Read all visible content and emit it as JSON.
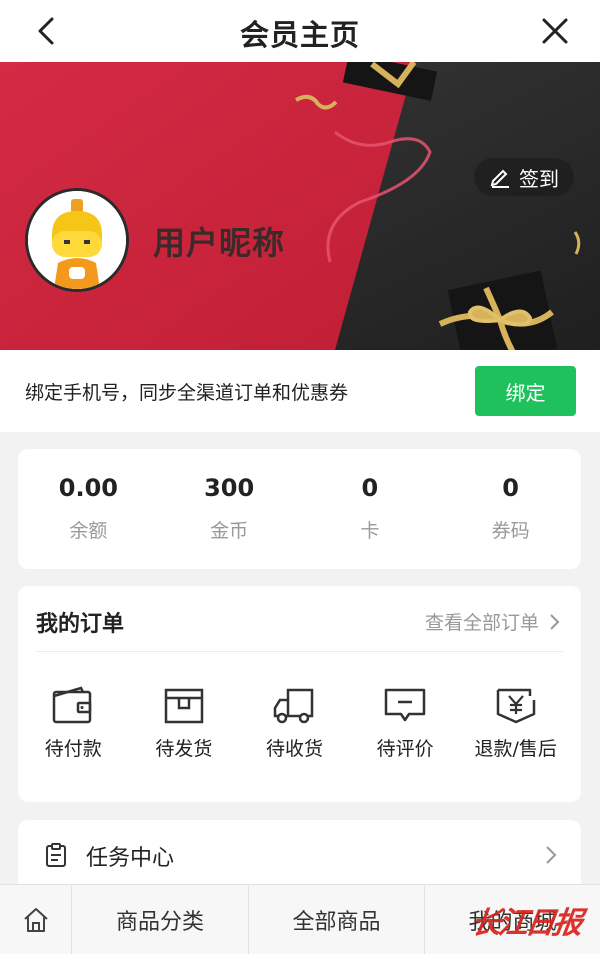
{
  "header": {
    "title": "会员主页"
  },
  "banner": {
    "nickname": "用户昵称",
    "signin_label": "签到"
  },
  "bind": {
    "prompt": "绑定手机号，同步全渠道订单和优惠券",
    "button_label": "绑定"
  },
  "stats": [
    {
      "value": "0.00",
      "label": "余额"
    },
    {
      "value": "300",
      "label": "金币"
    },
    {
      "value": "0",
      "label": "卡"
    },
    {
      "value": "0",
      "label": "券码"
    }
  ],
  "orders": {
    "title": "我的订单",
    "view_all": "查看全部订单",
    "items": [
      {
        "label": "待付款",
        "icon": "wallet-icon"
      },
      {
        "label": "待发货",
        "icon": "package-icon"
      },
      {
        "label": "待收货",
        "icon": "truck-icon"
      },
      {
        "label": "待评价",
        "icon": "comment-icon"
      },
      {
        "label": "退款/售后",
        "icon": "refund-icon"
      }
    ]
  },
  "task_center": {
    "label": "任务中心"
  },
  "tabbar": {
    "tabs": [
      "商品分类",
      "全部商品",
      "我的商城"
    ]
  },
  "watermark": "长江日报",
  "colors": {
    "accent_green": "#1fc15d",
    "banner_red": "#d3243c",
    "banner_dark": "#2a2a2a",
    "watermark_red": "#d8231c"
  }
}
